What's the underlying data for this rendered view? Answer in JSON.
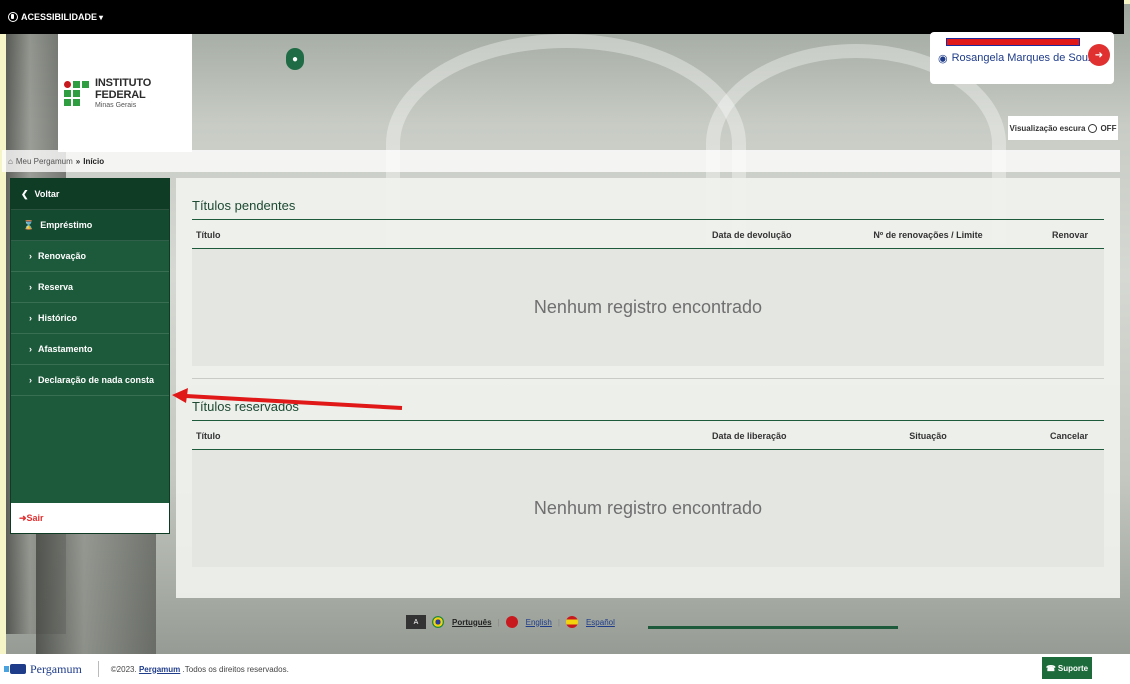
{
  "topbar": {
    "accessibility_label": "ACESSIBILIDADE",
    "chevron": "▾"
  },
  "logo": {
    "title": "INSTITUTO FEDERAL",
    "subtitle": "Minas Gerais"
  },
  "user": {
    "name": "Rosangela Marques de Souza"
  },
  "dark_mode": {
    "label": "Visualização escura",
    "state": "OFF"
  },
  "breadcrumb": {
    "root": "Meu Pergamum",
    "sep": "»",
    "current": "Início"
  },
  "sidebar": {
    "back": "Voltar",
    "loan": "Empréstimo",
    "items": [
      "Renovação",
      "Reserva",
      "Histórico",
      "Afastamento",
      "Declaração de nada consta"
    ],
    "exit": "Sair"
  },
  "pending": {
    "title": "Títulos pendentes",
    "columns": [
      "Título",
      "Data de devolução",
      "Nº de renovações / Limite",
      "Renovar"
    ],
    "empty": "Nenhum registro encontrado"
  },
  "reserved": {
    "title": "Títulos reservados",
    "columns": [
      "Título",
      "Data de liberação",
      "Situação",
      "Cancelar"
    ],
    "empty": "Nenhum registro encontrado"
  },
  "languages": {
    "pt": "Português",
    "en": "English",
    "es": "Español"
  },
  "footer": {
    "brand": "Pergamum",
    "copy_prefix": "©2023.",
    "copy_link": "Pergamum",
    "copy_suffix": ".Todos os direitos reservados.",
    "support": "Suporte"
  },
  "colors": {
    "primary_green": "#1d5a3b",
    "annotation_red": "#e01818"
  }
}
